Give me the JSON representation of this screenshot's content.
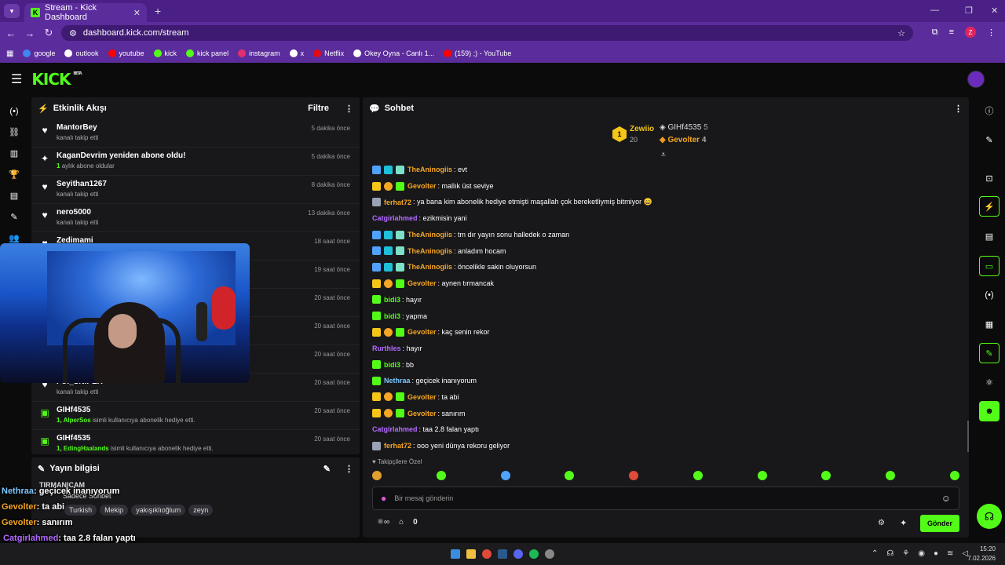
{
  "browser": {
    "tab_title": "Stream - Kick Dashboard",
    "url": "dashboard.kick.com/stream",
    "profile_letter": "Z",
    "bookmarks": [
      {
        "label": "google",
        "color": "#4285f4"
      },
      {
        "label": "outlook",
        "color": "#ffffff"
      },
      {
        "label": "youtube",
        "color": "#ff0000"
      },
      {
        "label": "kick",
        "color": "#53fc18"
      },
      {
        "label": "kick panel",
        "color": "#53fc18"
      },
      {
        "label": "instagram",
        "color": "#e1306c"
      },
      {
        "label": "x",
        "color": "#ffffff"
      },
      {
        "label": "Netflix",
        "color": "#e50914"
      },
      {
        "label": "Okey Oyna - Canlı 1...",
        "color": "#ffffff"
      },
      {
        "label": "(159) ;) - YouTube",
        "color": "#ff0000"
      }
    ]
  },
  "kick": {
    "logo": "KICK",
    "beta": "BETA"
  },
  "activity": {
    "title": "Etkinlik Akışı",
    "filter_label": "Filtre",
    "items": [
      {
        "name": "MantorBey",
        "sub": "kanalı takip etti",
        "time": "5 dakika önce",
        "icon": "heart-icon",
        "count": ""
      },
      {
        "name": "KaganDevrim yeniden abone oldu!",
        "sub": "aylık abone oldular",
        "time": "5 dakika önce",
        "icon": "sparkle-icon",
        "count": "1"
      },
      {
        "name": "Seyithan1267",
        "sub": "kanalı takip etti",
        "time": "8 dakika önce",
        "icon": "heart-icon",
        "count": ""
      },
      {
        "name": "nero5000",
        "sub": "kanalı takip etti",
        "time": "13 dakika önce",
        "icon": "heart-icon",
        "count": ""
      },
      {
        "name": "Zedimami",
        "sub": "kanalı takip etti",
        "time": "18 saat önce",
        "icon": "heart-icon",
        "count": ""
      },
      {
        "name": "",
        "sub": "",
        "time": "19 saat önce",
        "icon": "heart-icon",
        "count": ""
      },
      {
        "name": "",
        "sub": "",
        "time": "20 saat önce",
        "icon": "heart-icon",
        "count": ""
      },
      {
        "name": "",
        "sub": "",
        "time": "20 saat önce",
        "icon": "heart-icon",
        "count": ""
      },
      {
        "name": "",
        "sub": "",
        "time": "20 saat önce",
        "icon": "heart-icon",
        "count": ""
      },
      {
        "name": "FUI_SNIPER",
        "sub": "kanalı takip etti",
        "time": "20 saat önce",
        "icon": "heart-icon",
        "count": ""
      },
      {
        "name": "GIHf4535",
        "sub": "isimli kullanıcıya abonelik hediye etti.",
        "time": "20 saat önce",
        "icon": "gift-icon",
        "count": "1, AlperSos"
      },
      {
        "name": "GIHf4535",
        "sub": "isimli kullanıcıya abonelik hediye etti.",
        "time": "20 saat önce",
        "icon": "gift-icon",
        "count": "1, EdingHaalands"
      }
    ]
  },
  "stream_info": {
    "title": "Yayın bilgisi",
    "stream_title": "TIRMANICAM",
    "category": "Sadece Sohbet",
    "tags": [
      "Turkish",
      "Mekip",
      "yakışıklıoğlum",
      "zeyn"
    ]
  },
  "chat": {
    "title": "Sohbet",
    "leaderboard": [
      {
        "name": "Zewiio",
        "count": "20",
        "rank": "1"
      },
      {
        "name": "GIHf4535",
        "count": "5"
      },
      {
        "name": "Gevolter",
        "count": "4"
      }
    ],
    "messages": [
      {
        "user": "TheAninogiis",
        "text": ": evt",
        "color": "#f5a623",
        "badges": [
          "#4fa3ff",
          "#1ec0d9",
          "#7ee0c8"
        ]
      },
      {
        "user": "Gevolter",
        "text": ": mallık üst seviye",
        "color": "#f5a623",
        "badges": [
          "#f5c518",
          "#f5a623",
          "#53fc18"
        ]
      },
      {
        "user": "ferhat72",
        "text": ": ya bana kim abonelik hediye etmişti maşallah çok bereketliymiş bitmiyor 😄",
        "color": "#f5a623",
        "badges": [
          "#9aa3b5"
        ]
      },
      {
        "user": "Catgirlahmed",
        "text": ": ezikmisin yani",
        "color": "#b46cff",
        "badges": []
      },
      {
        "user": "TheAninogiis",
        "text": ": tm dır yayın sonu halledek o zaman",
        "color": "#f5a623",
        "badges": [
          "#4fa3ff",
          "#1ec0d9",
          "#7ee0c8"
        ]
      },
      {
        "user": "TheAninogiis",
        "text": ": anladım hocam",
        "color": "#f5a623",
        "badges": [
          "#4fa3ff",
          "#1ec0d9",
          "#7ee0c8"
        ]
      },
      {
        "user": "TheAninogiis",
        "text": ": öncelikle sakin oluyorsun",
        "color": "#f5a623",
        "badges": [
          "#4fa3ff",
          "#1ec0d9",
          "#7ee0c8"
        ]
      },
      {
        "user": "Gevolter",
        "text": ": aynen tırmancak",
        "color": "#f5a623",
        "badges": [
          "#f5c518",
          "#f5a623",
          "#53fc18"
        ]
      },
      {
        "user": "bidi3",
        "text": ": hayır",
        "color": "#53fc18",
        "badges": [
          "#53fc18"
        ]
      },
      {
        "user": "bidi3",
        "text": ": yapma",
        "color": "#53fc18",
        "badges": [
          "#53fc18"
        ]
      },
      {
        "user": "Gevolter",
        "text": ": kaç senin rekor",
        "color": "#f5a623",
        "badges": [
          "#f5c518",
          "#f5a623",
          "#53fc18"
        ]
      },
      {
        "user": "Rurthles",
        "text": ": hayır",
        "color": "#b46cff",
        "badges": []
      },
      {
        "user": "bidi3",
        "text": ": bb",
        "color": "#53fc18",
        "badges": [
          "#53fc18"
        ]
      },
      {
        "user": "Nethraa",
        "text": ": geçicek inanıyorum",
        "color": "#7ec8ff",
        "badges": [
          "#53fc18"
        ]
      },
      {
        "user": "Gevolter",
        "text": ": ta abi",
        "color": "#f5a623",
        "badges": [
          "#f5c518",
          "#f5a623",
          "#53fc18"
        ]
      },
      {
        "user": "Gevolter",
        "text": ": sanırım",
        "color": "#f5a623",
        "badges": [
          "#f5c518",
          "#f5a623",
          "#53fc18"
        ]
      },
      {
        "user": "Catgirlahmed",
        "text": ": taa 2.8 falan yaptı",
        "color": "#b46cff",
        "badges": []
      },
      {
        "user": "ferhat72",
        "text": ": ooo yeni dünya rekoru geliyor",
        "color": "#f5a623",
        "badges": [
          "#9aa3b5"
        ]
      }
    ],
    "followers_only": "Takipçilere Özel",
    "input_placeholder": "Bir mesaj gönderin",
    "points": "0",
    "send_label": "Gönder"
  },
  "overlay_chat": [
    {
      "user": "Nethraa",
      "text": ": geçicek inanıyorum",
      "color": "#7ec8ff"
    },
    {
      "user": "Gevolter",
      "text": ": ta abi",
      "color": "#f5a623"
    },
    {
      "user": "Gevolter",
      "text": ": sanırım",
      "color": "#f5a623"
    },
    {
      "user": "Catgirlahmed",
      "text": ": taa 2.8 falan yaptı",
      "color": "#b46cff"
    },
    {
      "user": "ferhat72",
      "text": ": ooo yeni dünya rekoru geliyor",
      "color": "#f5a623"
    }
  ],
  "taskbar": {
    "time": "15:20",
    "date": "7.02.2026"
  },
  "colors": {
    "accent": "#53fc18",
    "browser_purple": "#5b2c9c"
  }
}
